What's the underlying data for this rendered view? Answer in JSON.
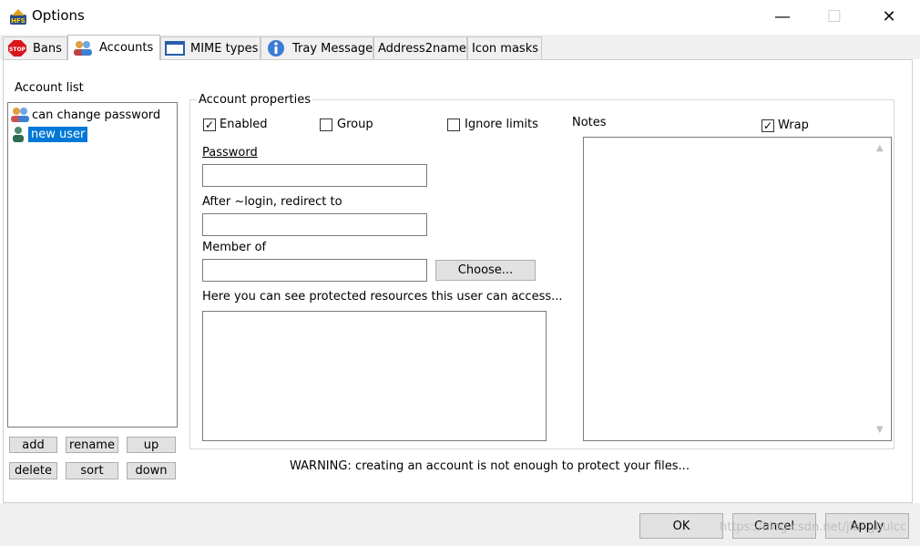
{
  "window": {
    "title": "Options",
    "icon": "hfs-app-icon",
    "controls": {
      "minimize": "—",
      "maximize": "☐",
      "close": "✕"
    }
  },
  "tabs": [
    {
      "label": "Bans",
      "icon": "stop-icon"
    },
    {
      "label": "Accounts",
      "icon": "users-icon",
      "active": true
    },
    {
      "label": "MIME types",
      "icon": "window-icon"
    },
    {
      "label": "Tray Message",
      "icon": "info-icon"
    },
    {
      "label": "Address2name"
    },
    {
      "label": "Icon masks"
    }
  ],
  "account_list": {
    "label": "Account list",
    "items": [
      {
        "name": "can change password",
        "icon": "group-icon"
      },
      {
        "name": "new user",
        "icon": "user-icon",
        "selected": true
      }
    ],
    "buttons": {
      "add": "add",
      "rename": "rename",
      "up": "up",
      "delete": "delete",
      "sort": "sort",
      "down": "down"
    }
  },
  "account_properties": {
    "group_label": "Account properties",
    "enabled": {
      "label": "Enabled",
      "checked": true
    },
    "group": {
      "label": "Group",
      "checked": false
    },
    "ignore_limits": {
      "label": "Ignore limits",
      "checked": false
    },
    "password": {
      "label": "Password",
      "value": ""
    },
    "redirect": {
      "label": "After ~login, redirect to",
      "value": ""
    },
    "member_of": {
      "label": "Member of",
      "value": "",
      "choose_button": "Choose..."
    },
    "resources": {
      "label": "Here you can see protected resources this user can access...",
      "value": ""
    },
    "notes": {
      "label": "Notes",
      "wrap_label": "Wrap",
      "wrap_checked": true,
      "value": ""
    }
  },
  "warning": "WARNING: creating an account is not enough to protect  your files...",
  "footer": {
    "ok": "OK",
    "cancel": "Cancel",
    "apply": "Apply"
  },
  "watermark": "https://blog.csdn.net/jiangbulcc",
  "colors": {
    "selection": "#0078d7",
    "button_face": "#e1e1e1",
    "chrome": "#f0f0f0"
  }
}
